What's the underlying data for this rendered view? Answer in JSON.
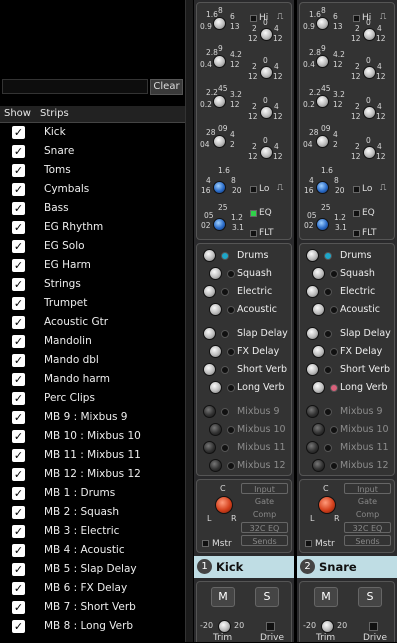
{
  "clear_button": "Clear",
  "list_header": {
    "show": "Show",
    "strips": "Strips"
  },
  "strips": [
    "Kick",
    "Snare",
    "Toms",
    "Cymbals",
    "Bass",
    "EG Rhythm",
    "EG Solo",
    "EG Harm",
    "Strings",
    "Trumpet",
    "Acoustic Gtr",
    "Mandolin",
    "Mando dbl",
    "Mando harm",
    "Perc Clips",
    "MB 9 : Mixbus 9",
    "MB 10 : Mixbus 10",
    "MB 11 : Mixbus 11",
    "MB 12 : Mixbus 12",
    "MB 1 : Drums",
    "MB 2 : Squash",
    "MB 3 : Electric",
    "MB 4 : Acoustic",
    "MB 5 : Slap Delay",
    "MB 6 : FX Delay",
    "MB 7 : Short Verb",
    "MB 8 : Long Verb"
  ],
  "checkmark": "✓",
  "eq": {
    "hi": "Hi",
    "lo": "Lo",
    "eq": "EQ",
    "flt": "FLT",
    "shelf_glyph": "⎍",
    "rows": [
      {
        "a": [
          "1.6",
          "8",
          "6",
          "0.9",
          "13"
        ],
        "b": [
          "2",
          "0",
          "4",
          "12",
          "12"
        ]
      },
      {
        "a": [
          "2.8",
          "9",
          "4.2",
          "0.4",
          "12"
        ],
        "b": [
          "2",
          "0",
          "4",
          "12",
          "12"
        ]
      },
      {
        "a": [
          "2.2",
          "45",
          "3.2",
          "0.2",
          "12"
        ],
        "b": [
          "2",
          "0",
          "4",
          "12",
          "12"
        ]
      },
      {
        "a": [
          "28",
          "09",
          "4",
          "04",
          "2"
        ],
        "b": [
          "2",
          "0",
          "4",
          "12",
          "12"
        ]
      },
      {
        "a": [
          "1.6",
          "4",
          "8",
          "16",
          "20"
        ]
      },
      {
        "a": [
          "25",
          "05",
          "1.2",
          "02",
          "3.1"
        ]
      }
    ]
  },
  "sends": [
    "Drums",
    "Squash",
    "Electric",
    "Acoustic",
    "Slap Delay",
    "FX Delay",
    "Short Verb",
    "Long Verb",
    "Mixbus 9",
    "Mixbus 10",
    "Mixbus 11",
    "Mixbus 12"
  ],
  "routing": {
    "items": [
      "Input",
      "Gate",
      "Comp",
      "32C EQ",
      "Sends"
    ],
    "mstr": "Mstr",
    "c": "C",
    "l": "L",
    "r": "R"
  },
  "channels": [
    {
      "num": "1",
      "name": "Kick"
    },
    {
      "num": "2",
      "name": "Snare"
    }
  ],
  "bottom": {
    "m": "M",
    "s": "S",
    "trim_min": "-20",
    "trim_max": "20",
    "trim": "Trim",
    "drive": "Drive"
  }
}
